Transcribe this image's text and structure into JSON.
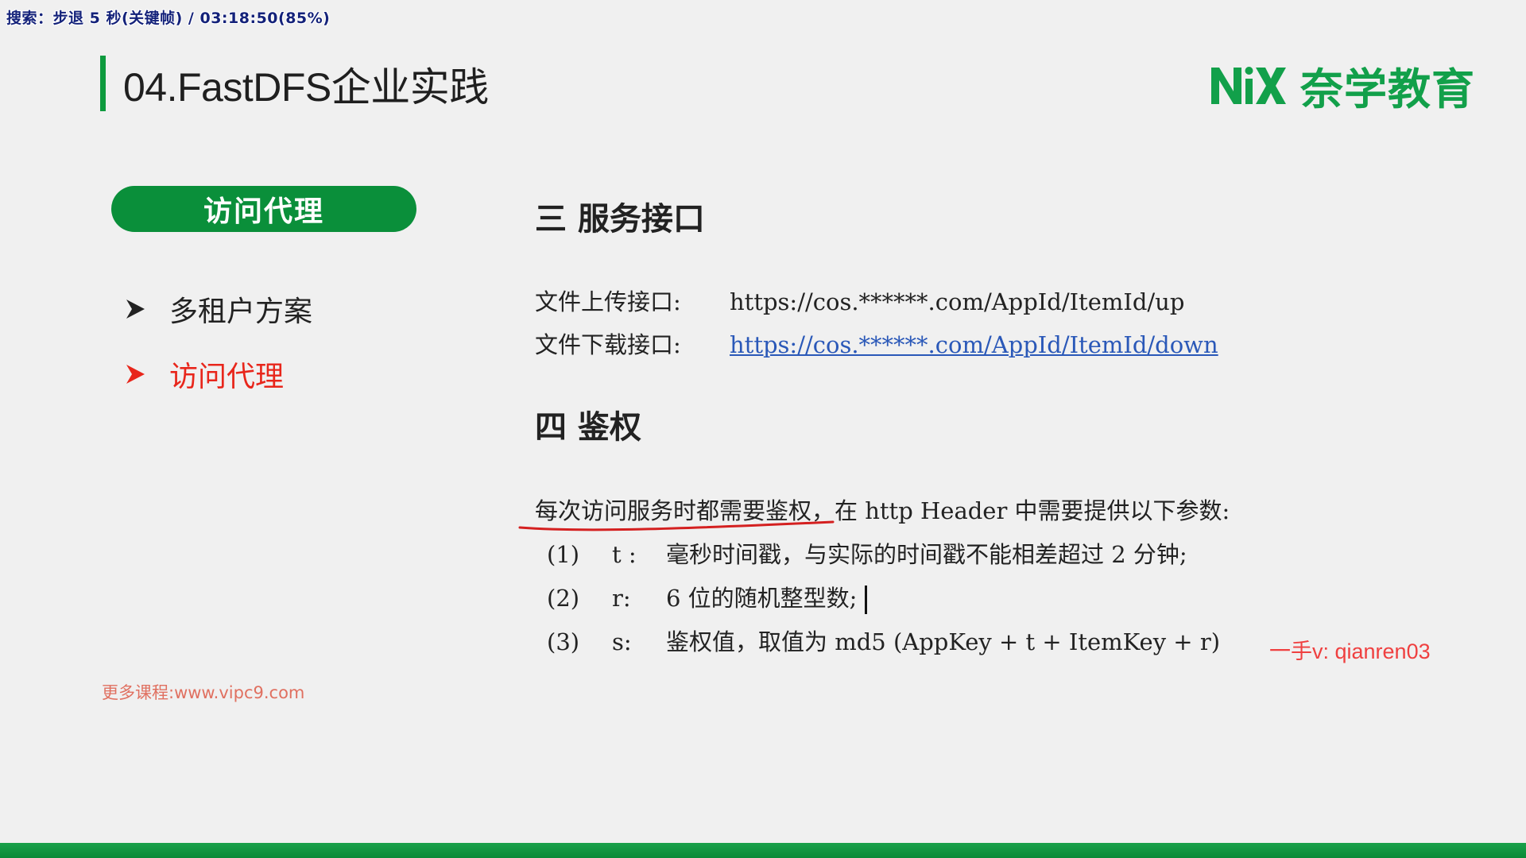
{
  "player": {
    "status_text": "搜索：步退 5 秒(关键帧) / 03:18:50(85%)"
  },
  "slide": {
    "title": "04.FastDFS企业实践",
    "logo": {
      "mark": "NiX",
      "text": "奈学教育",
      "color": "#12a04a"
    },
    "sidebar": {
      "active_pill": "访问代理",
      "items": [
        {
          "label": "多租户方案",
          "active": false
        },
        {
          "label": "访问代理",
          "active": true
        }
      ]
    },
    "footer_link": "更多课程:www.vipc9.com",
    "section3": {
      "heading": "三  服务接口",
      "rows": [
        {
          "label": "文件上传接口:",
          "url": "https://cos.******.com/AppId/ItemId/up"
        },
        {
          "label": "文件下载接口:",
          "url": "https://cos.******.com/AppId/ItemId/down"
        }
      ]
    },
    "section4": {
      "heading": "四  鉴权",
      "intro": "每次访问服务时都需要鉴权，在 http Header 中需要提供以下参数:",
      "items": [
        {
          "num": "(1)",
          "key": "t :",
          "desc": "毫秒时间戳，与实际的时间戳不能相差超过 2 分钟;"
        },
        {
          "num": "(2)",
          "key": "r:",
          "desc": "6 位的随机整型数;"
        },
        {
          "num": "(3)",
          "key": "s:",
          "desc": "鉴权值，取值为 md5 (AppKey + t + ItemKey + r)"
        }
      ]
    },
    "watermark": "一手v: qianren03",
    "colors": {
      "accent_green": "#0a8f3a",
      "active_red": "#e8261b",
      "link_blue": "#2a58b8"
    }
  }
}
